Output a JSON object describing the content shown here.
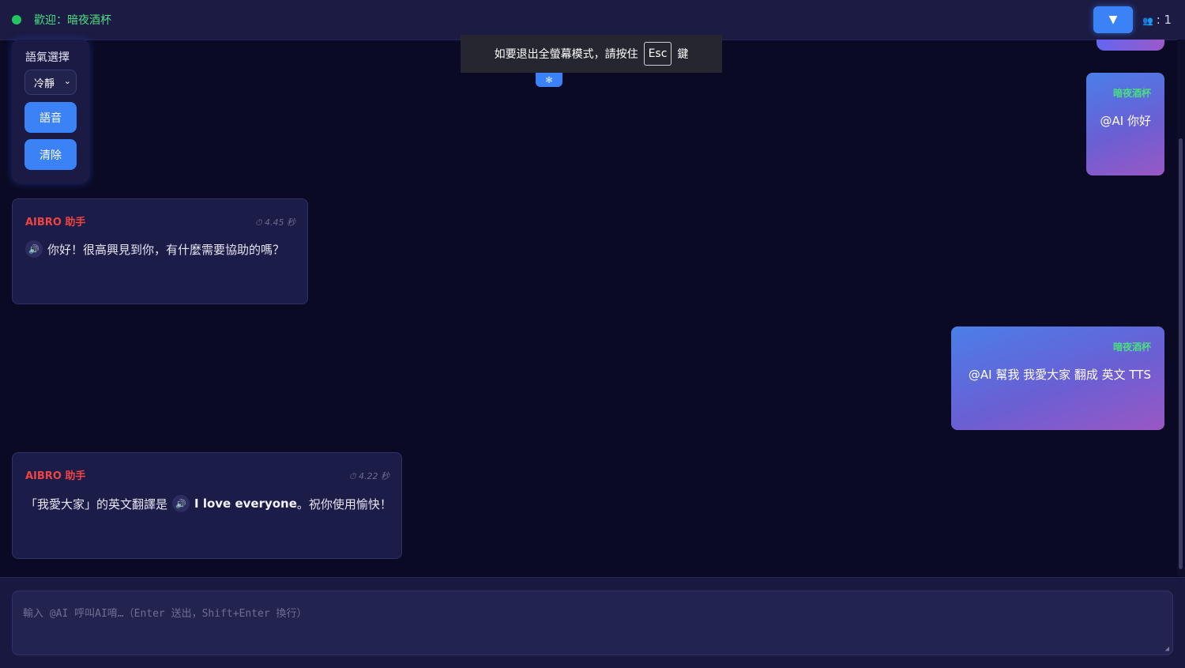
{
  "header": {
    "welcome": "歡迎：暗夜酒杯",
    "dropdown_icon": "▼",
    "user_count": ": 1",
    "users_icon": "users-icon"
  },
  "side_panel": {
    "title": "語氣選擇",
    "mood_selected": "冷靜",
    "voice_label": "語音",
    "clear_label": "清除"
  },
  "fullscreen_notice": {
    "prefix": "如要退出全螢幕模式，請按住",
    "key": "Esc",
    "suffix": "鍵"
  },
  "messages": [
    {
      "sender": "暗夜酒杯",
      "text": "@AI 你好"
    },
    {
      "sender": "AIBRO 助手",
      "time": "⏱ 4.45 秒",
      "text": "你好！很高興見到你，有什麼需要協助的嗎？"
    },
    {
      "sender": "暗夜酒杯",
      "text": "@AI 幫我 我愛大家 翻成 英文  TTS"
    },
    {
      "sender": "AIBRO 助手",
      "time": "⏱ 4.22 秒",
      "text_before": "「我愛大家」的英文翻譯是",
      "text_en": "I love everyone",
      "text_after": "。祝你使用愉快！"
    }
  ],
  "composer": {
    "placeholder": "輸入 @AI 呼叫AI唷…（Enter 送出，Shift+Enter 換行）"
  },
  "colors": {
    "background": "#0a0a24",
    "accent_blue": "#3b82f6",
    "ai_name": "#ef4444",
    "user_name": "#4ade80",
    "online": "#22c55e"
  }
}
